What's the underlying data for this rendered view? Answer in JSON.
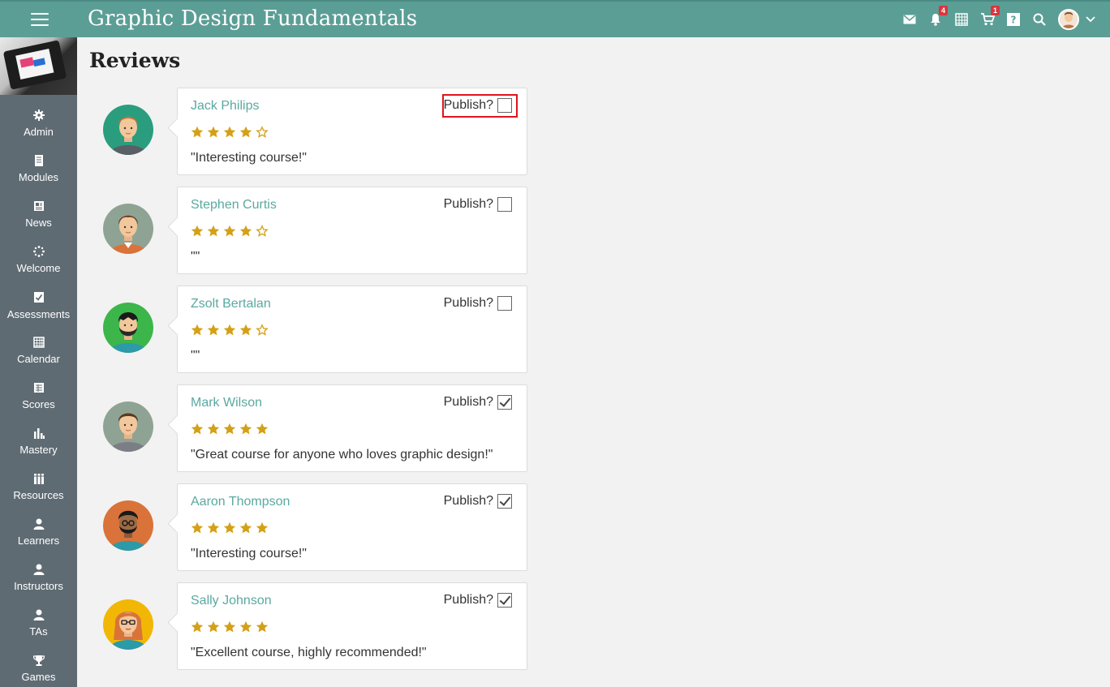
{
  "app": {
    "title": "Graphic Design Fundamentals"
  },
  "topbar": {
    "notification_count": "4",
    "cart_count": "1"
  },
  "sidebar": {
    "items": [
      {
        "label": "Admin",
        "icon": "gear-icon"
      },
      {
        "label": "Modules",
        "icon": "book-icon"
      },
      {
        "label": "News",
        "icon": "news-icon"
      },
      {
        "label": "Welcome",
        "icon": "spinner-icon"
      },
      {
        "label": "Assessments",
        "icon": "checklist-icon"
      },
      {
        "label": "Calendar",
        "icon": "calendar-icon"
      },
      {
        "label": "Scores",
        "icon": "scores-icon"
      },
      {
        "label": "Mastery",
        "icon": "bar-chart-icon"
      },
      {
        "label": "Resources",
        "icon": "library-icon"
      },
      {
        "label": "Learners",
        "icon": "user-icon"
      },
      {
        "label": "Instructors",
        "icon": "user-icon"
      },
      {
        "label": "TAs",
        "icon": "user-icon"
      },
      {
        "label": "Games",
        "icon": "trophy-icon"
      }
    ]
  },
  "main": {
    "title": "Reviews",
    "publish_label": "Publish?",
    "reviews": [
      {
        "name": "Jack Philips",
        "rating": 4,
        "comment": "\"Interesting course!\"",
        "published": false,
        "highlighted": true
      },
      {
        "name": "Stephen Curtis",
        "rating": 4,
        "comment": "\"\"",
        "published": false,
        "highlighted": false
      },
      {
        "name": "Zsolt Bertalan",
        "rating": 4,
        "comment": "\"\"",
        "published": false,
        "highlighted": false
      },
      {
        "name": "Mark Wilson",
        "rating": 5,
        "comment": "\"Great course for anyone who loves graphic design!\"",
        "published": true,
        "highlighted": false
      },
      {
        "name": "Aaron Thompson",
        "rating": 5,
        "comment": "\"Interesting course!\"",
        "published": true,
        "highlighted": false
      },
      {
        "name": "Sally Johnson",
        "rating": 5,
        "comment": "\"Excellent course, highly recommended!\"",
        "published": true,
        "highlighted": false
      }
    ]
  },
  "colors": {
    "topbar": "#5b9e96",
    "sidebar": "#5f6b73",
    "accent_link": "#5aa9a0",
    "star": "#d4a017",
    "highlight": "#e0141b"
  }
}
